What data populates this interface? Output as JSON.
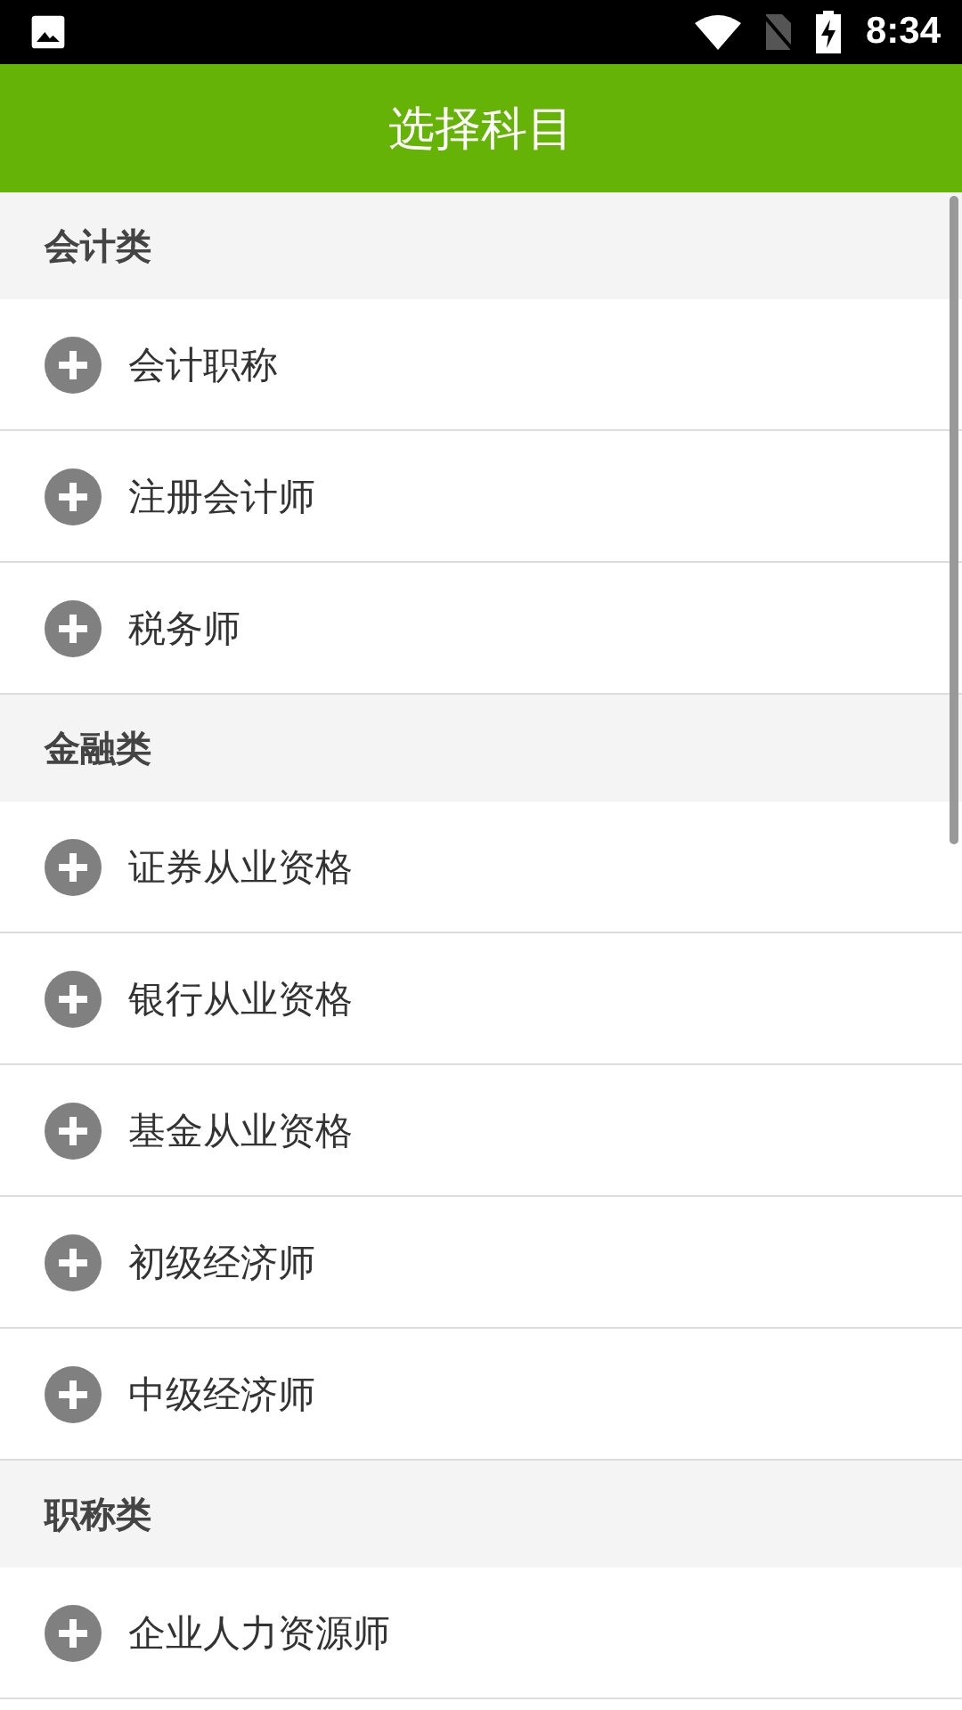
{
  "status_bar": {
    "time": "8:34"
  },
  "app_bar": {
    "title": "选择科目"
  },
  "sections": [
    {
      "title": "会计类",
      "items": [
        "会计职称",
        "注册会计师",
        "税务师"
      ]
    },
    {
      "title": "金融类",
      "items": [
        "证券从业资格",
        "银行从业资格",
        "基金从业资格",
        "初级经济师",
        "中级经济师"
      ]
    },
    {
      "title": "职称类",
      "items": [
        "企业人力资源师"
      ]
    }
  ]
}
